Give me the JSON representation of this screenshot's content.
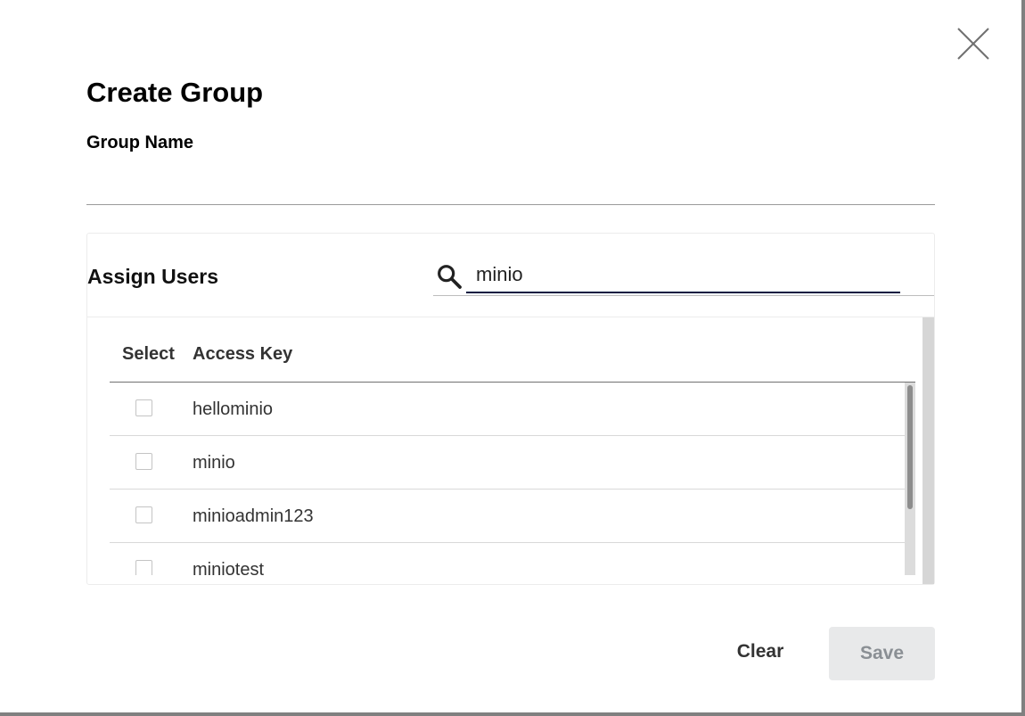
{
  "modal": {
    "title": "Create Group",
    "close_icon": "close-icon"
  },
  "group_name": {
    "label": "Group Name",
    "value": "",
    "placeholder": ""
  },
  "assign_users": {
    "label": "Assign Users",
    "search_icon": "search-icon",
    "search_value": "minio",
    "table": {
      "columns": [
        "Select",
        "Access Key"
      ],
      "rows": [
        {
          "access_key": "hellominio",
          "selected": false
        },
        {
          "access_key": "minio",
          "selected": false
        },
        {
          "access_key": "minioadmin123",
          "selected": false
        },
        {
          "access_key": "miniotest",
          "selected": false
        }
      ]
    }
  },
  "actions": {
    "clear_label": "Clear",
    "save_label": "Save"
  },
  "colors": {
    "search_underline": "#081c42",
    "save_disabled_bg": "#e8e9ea",
    "save_disabled_text": "#8a8f94"
  }
}
